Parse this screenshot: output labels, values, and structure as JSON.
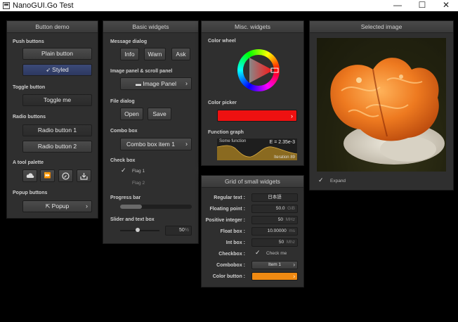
{
  "window": {
    "title": "NanoGUI.Go Test",
    "minimize": "—",
    "maximize": "☐",
    "close": "✕"
  },
  "button_demo": {
    "title": "Button demo",
    "push_label": "Push buttons",
    "plain_button": "Plain button",
    "styled_button": "Styled",
    "toggle_label": "Toggle button",
    "toggle_button": "Toggle me",
    "radio_label": "Radio buttons",
    "radio1": "Radio button 1",
    "radio2": "Radio button 2",
    "palette_label": "A tool palette",
    "popup_label": "Popup buttons",
    "popup_button": "Popup"
  },
  "basic_widgets": {
    "title": "Basic widgets",
    "message_label": "Message dialog",
    "info": "Info",
    "warn": "Warn",
    "ask": "Ask",
    "image_panel_label": "Image panel & scroll panel",
    "image_panel_button": "Image Panel",
    "file_label": "File dialog",
    "open": "Open",
    "save": "Save",
    "combo_label": "Combo box",
    "combo_value": "Combo box item 1",
    "check_label": "Check box",
    "flag1": "Flag 1",
    "flag2": "Flag 2",
    "progress_label": "Progress bar",
    "progress_value": 0.3,
    "slider_label": "Slider and text box",
    "slider_value": "50",
    "slider_unit": "%"
  },
  "misc_widgets": {
    "title": "Misc. widgets",
    "wheel_label": "Color wheel",
    "picker_label": "Color picker",
    "picker_color": "#ee1111",
    "graph_label": "Function graph",
    "graph_caption": "Some function",
    "graph_value": "E = 2.35e-3",
    "graph_footer": "Iteration 89"
  },
  "grid": {
    "title": "Grid of small widgets",
    "regular_label": "Regular text :",
    "regular_value": "日本語",
    "float_label": "Floating point :",
    "float_value": "50.0",
    "float_unit": "GiB",
    "int_label": "Positive integer :",
    "int_value": "50",
    "int_unit": "MHz",
    "floatbox_label": "Float box :",
    "floatbox_value": "10.00000",
    "floatbox_unit": "ms",
    "intbox_label": "Int box :",
    "intbox_value": "50",
    "intbox_unit": "Mhz",
    "checkbox_label": "Checkbox :",
    "checkbox_text": "Check me",
    "combobox_label": "Combobox :",
    "combobox_value": "Item 1",
    "colorbtn_label": "Color button :",
    "colorbtn_color": "#f08a12"
  },
  "selected_image": {
    "title": "Selected image",
    "expand_label": "Expand"
  }
}
